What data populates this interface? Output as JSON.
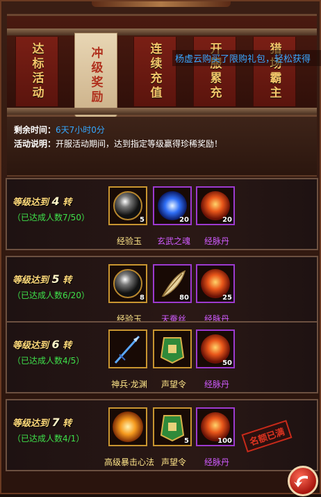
{
  "tabs": [
    {
      "label": "达标活动",
      "active": false
    },
    {
      "label": "冲级奖励",
      "active": true
    },
    {
      "label": "连续充值",
      "active": false
    },
    {
      "label": "开服累充",
      "active": false
    },
    {
      "label": "猎场霸主",
      "active": false
    }
  ],
  "marquee": "杨虚云购买了限购礼包，轻松获得",
  "info": {
    "remaining_label": "剩余时间：",
    "remaining_value": "6天7小时0分",
    "desc_label": "活动说明：",
    "desc_value": "开服活动期间，达到指定等级赢得珍稀奖励！"
  },
  "rows": [
    {
      "title_pre": "等级达到",
      "level": "4",
      "title_post": "转",
      "count": "（已达成人数7/50）",
      "items": [
        {
          "name": "经验玉",
          "qty": "5",
          "icon": "orb-icon",
          "rarity": "gold"
        },
        {
          "name": "玄武之魂",
          "qty": "20",
          "icon": "blue-soul-icon",
          "rarity": "purple"
        },
        {
          "name": "经脉丹",
          "qty": "20",
          "icon": "fire-pill-icon",
          "rarity": "purple"
        }
      ]
    },
    {
      "title_pre": "等级达到",
      "level": "5",
      "title_post": "转",
      "count": "（已达成人数6/20）",
      "items": [
        {
          "name": "经验玉",
          "qty": "8",
          "icon": "orb-icon",
          "rarity": "gold"
        },
        {
          "name": "天蚕丝",
          "qty": "80",
          "icon": "feather-icon",
          "rarity": "purple"
        },
        {
          "name": "经脉丹",
          "qty": "25",
          "icon": "fire-pill-icon",
          "rarity": "purple"
        }
      ]
    },
    {
      "title_pre": "等级达到",
      "level": "6",
      "title_post": "转",
      "count": "（已达成人数4/5）",
      "items": [
        {
          "name": "神兵·龙渊",
          "qty": "",
          "icon": "spear-icon",
          "rarity": "gold"
        },
        {
          "name": "声望令",
          "qty": "",
          "icon": "token-icon",
          "rarity": "gold"
        },
        {
          "name": "经脉丹",
          "qty": "50",
          "icon": "fire-pill-icon",
          "rarity": "purple"
        }
      ]
    },
    {
      "title_pre": "等级达到",
      "level": "7",
      "title_post": "转",
      "count": "（已达成人数4/1）",
      "items": [
        {
          "name": "高级暴击心法",
          "qty": "",
          "icon": "sun-orb-icon",
          "rarity": "gold"
        },
        {
          "name": "声望令",
          "qty": "5",
          "icon": "token-icon",
          "rarity": "gold"
        },
        {
          "name": "经脉丹",
          "qty": "100",
          "icon": "fire-pill-icon",
          "rarity": "purple"
        }
      ],
      "stamp": "名额已满"
    }
  ],
  "colors": {
    "gold": "#ffe68a",
    "purple": "#d05cff",
    "count": "#3ee04a",
    "time": "#35a8ff"
  }
}
